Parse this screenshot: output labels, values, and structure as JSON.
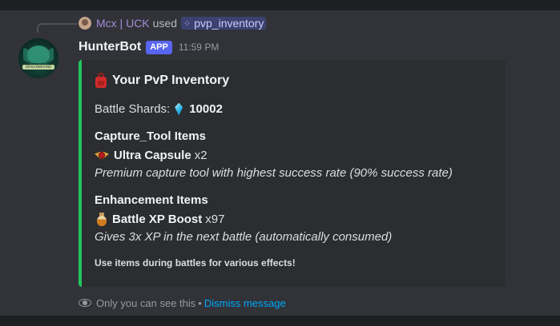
{
  "reply": {
    "user": "Mcx | UCK",
    "used": "used",
    "command": "pvp_inventory",
    "command_icon": "slash-command-icon"
  },
  "message": {
    "username": "HunterBot",
    "app_tag": "APP",
    "timestamp": "11:59 PM",
    "avatar_text": "DRAGONBOUND"
  },
  "embed": {
    "accent_color": "#23c55e",
    "title": "Your PvP Inventory",
    "shards_label": "Battle Shards:",
    "shards_value": "10002",
    "sections": [
      {
        "heading": "Capture_Tool Items",
        "item_name": "Ultra Capsule",
        "item_qty": "x2",
        "item_desc": "Premium capture tool with highest success rate (90% success rate)"
      },
      {
        "heading": "Enhancement Items",
        "item_name": "Battle XP Boost",
        "item_qty": "x97",
        "item_desc": "Gives 3x XP in the next battle (automatically consumed)"
      }
    ],
    "footer_note": "Use items during battles for various effects!"
  },
  "ephemeral": {
    "text": "Only you can see this",
    "separator": "•",
    "dismiss": "Dismiss message"
  }
}
